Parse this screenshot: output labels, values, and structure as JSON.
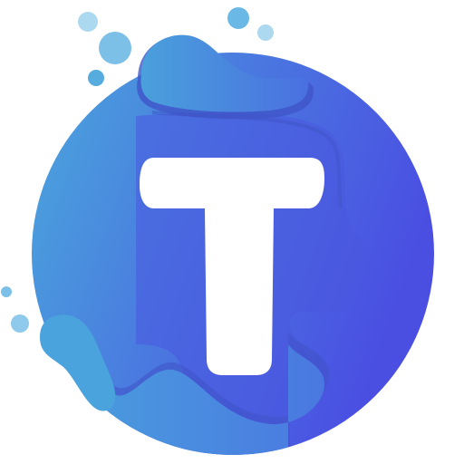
{
  "logo": {
    "letter": "T",
    "colors": {
      "background": "#ffffff",
      "circle_light": "#4aa6dc",
      "circle_dark": "#4a57e0",
      "splash_light": "#4ba3dd",
      "splash_mid": "#4a7fe0",
      "splash_shadow": "#3f55c8",
      "bubble_pale": "#acd8f0",
      "bubble_mid": "#7cc0e8",
      "bubble_strong": "#56acdf",
      "letter": "#ffffff"
    }
  }
}
